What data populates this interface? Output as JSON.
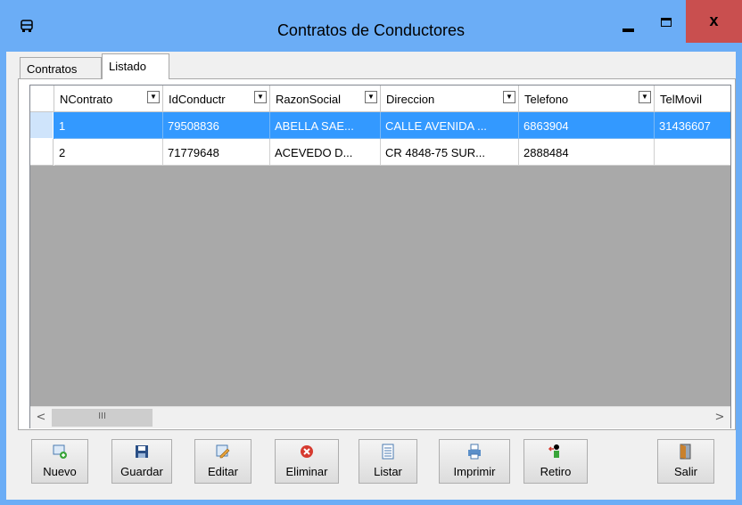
{
  "window": {
    "title": "Contratos de Conductores",
    "close_glyph": "x"
  },
  "tabs": [
    {
      "label": "Contratos",
      "selected": false
    },
    {
      "label": "Listado",
      "selected": true
    }
  ],
  "grid": {
    "columns": [
      "NContrato",
      "IdConductr",
      "RazonSocial",
      "Direccion",
      "Telefono",
      "TelMovil"
    ],
    "rows": [
      {
        "cells": [
          "1",
          "79508836",
          "ABELLA SAE...",
          "CALLE AVENIDA ...",
          "6863904",
          "31436607"
        ],
        "selected": true
      },
      {
        "cells": [
          "2",
          "71779648",
          "ACEVEDO D...",
          "CR 4848-75 SUR...",
          "2888484",
          ""
        ],
        "selected": false
      }
    ],
    "selection_color": "#3399ff"
  },
  "scrollbar": {
    "left_arrow": "<",
    "right_arrow": ">",
    "grip": "III"
  },
  "toolbar": {
    "nuevo": "Nuevo",
    "guardar": "Guardar",
    "editar": "Editar",
    "eliminar": "Eliminar",
    "listar": "Listar",
    "imprimir": "Imprimir",
    "retiro": "Retiro",
    "salir": "Salir"
  },
  "icons": [
    "bus-icon",
    "new-doc-icon",
    "save-icon",
    "edit-icon",
    "delete-icon",
    "list-icon",
    "print-icon",
    "retire-icon",
    "exit-door-icon"
  ],
  "colors": {
    "titlebar": "#6badf6",
    "close_button": "#c94f4f",
    "grid_background": "#a9a9a9"
  }
}
